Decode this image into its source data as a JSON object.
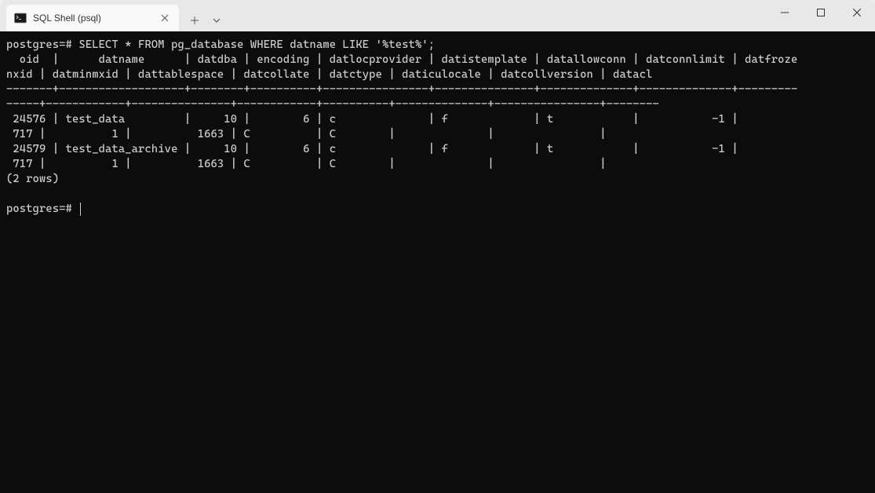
{
  "window": {
    "tab_title": "SQL Shell (psql)"
  },
  "terminal": {
    "prompt": "postgres=#",
    "command": "SELECT * FROM pg_database WHERE datname LIKE '%test%';",
    "header_line1": "  oid  |      datname      | datdba | encoding | datlocprovider | datistemplate | datallowconn | datconnlimit | datfroze",
    "header_line2": "nxid | datminmxid | dattablespace | datcollate | datctype | daticulocale | datcollversion | datacl",
    "separator_line1": "-------+-------------------+--------+----------+----------------+---------------+--------------+--------------+---------",
    "separator_line2": "-----+------------+---------------+------------+----------+--------------+----------------+--------",
    "row1_line1": " 24576 | test_data         |     10 |        6 | c              | f             | t            |           -1 |         ",
    "row1_line2": " 717 |          1 |          1663 | C          | C        |              |                |",
    "row2_line1": " 24579 | test_data_archive |     10 |        6 | c              | f             | t            |           -1 |         ",
    "row2_line2": " 717 |          1 |          1663 | C          | C        |              |                |",
    "footer": "(2 rows)",
    "blank": "",
    "prompt2": "postgres=# "
  },
  "query_result": {
    "columns": [
      "oid",
      "datname",
      "datdba",
      "encoding",
      "datlocprovider",
      "datistemplate",
      "datallowconn",
      "datconnlimit",
      "datfrozenxid",
      "datminmxid",
      "dattablespace",
      "datcollate",
      "datctype",
      "daticulocale",
      "datcollversion",
      "datacl"
    ],
    "rows": [
      {
        "oid": 24576,
        "datname": "test_data",
        "datdba": 10,
        "encoding": 6,
        "datlocprovider": "c",
        "datistemplate": "f",
        "datallowconn": "t",
        "datconnlimit": -1,
        "datfrozenxid": 717,
        "datminmxid": 1,
        "dattablespace": 1663,
        "datcollate": "C",
        "datctype": "C",
        "daticulocale": "",
        "datcollversion": "",
        "datacl": ""
      },
      {
        "oid": 24579,
        "datname": "test_data_archive",
        "datdba": 10,
        "encoding": 6,
        "datlocprovider": "c",
        "datistemplate": "f",
        "datallowconn": "t",
        "datconnlimit": -1,
        "datfrozenxid": 717,
        "datminmxid": 1,
        "dattablespace": 1663,
        "datcollate": "C",
        "datctype": "C",
        "daticulocale": "",
        "datcollversion": "",
        "datacl": ""
      }
    ],
    "row_count": 2
  }
}
